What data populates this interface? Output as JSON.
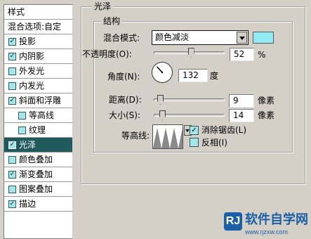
{
  "styles_panel": {
    "title": "样式",
    "blend_options": "混合选项:自定",
    "items": [
      {
        "label": "投影",
        "checked": true
      },
      {
        "label": "内阴影",
        "checked": true
      },
      {
        "label": "外发光",
        "checked": false
      },
      {
        "label": "内发光",
        "checked": false
      },
      {
        "label": "斜面和浮雕",
        "checked": true
      },
      {
        "label": "等高线",
        "checked": false
      },
      {
        "label": "纹理",
        "checked": false
      },
      {
        "label": "光泽",
        "checked": true,
        "selected": true
      },
      {
        "label": "颜色叠加",
        "checked": false
      },
      {
        "label": "渐变叠加",
        "checked": true
      },
      {
        "label": "图案叠加",
        "checked": false
      },
      {
        "label": "描边",
        "checked": true
      }
    ]
  },
  "satin": {
    "group_title": "光泽",
    "structure_title": "结构",
    "blend_mode_label": "混合模式:",
    "blend_mode_value": "颜色减淡",
    "blend_color": "#94eaf2",
    "opacity_label": "不透明度(O):",
    "opacity_value": "52",
    "opacity_unit": "%",
    "opacity_level": 0.52,
    "angle_label": "角度(N):",
    "angle_value": "132",
    "angle_unit": "度",
    "distance_label": "距离(D):",
    "distance_value": "9",
    "distance_unit": "像素",
    "size_label": "大小(S):",
    "size_value": "14",
    "size_unit": "像素",
    "contour_label": "等高线:",
    "antialias_label": "消除锯齿(L)",
    "antialias_checked": true,
    "invert_label": "反相(I)",
    "invert_checked": false
  },
  "watermark": {
    "logo": "RJ",
    "title": "软件自学网",
    "url": "www.rjzxw.com"
  }
}
